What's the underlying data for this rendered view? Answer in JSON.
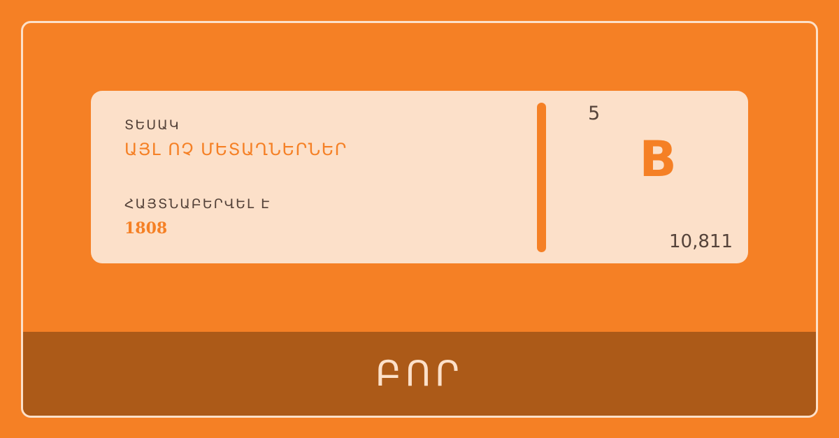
{
  "colors": {
    "background": "#f58025",
    "card": "#fce0c9",
    "accent": "#f58025",
    "band": "#ac5a18",
    "text_dark": "#55433a",
    "text_light": "#fce0c9"
  },
  "info": {
    "type_label": "ՏԵՍԱԿ",
    "type_value": "ԱՅԼ ՈՉ ՄԵՏԱՂՆԵՐՆԵՐ",
    "discovered_label": "ՀԱՅՏՆԱԲԵՐՎԵԼ Է",
    "discovered_value": "1808"
  },
  "element": {
    "atomic_number": "5",
    "symbol": "B",
    "atomic_mass": "10,811",
    "name": "ԲՈՐ"
  }
}
